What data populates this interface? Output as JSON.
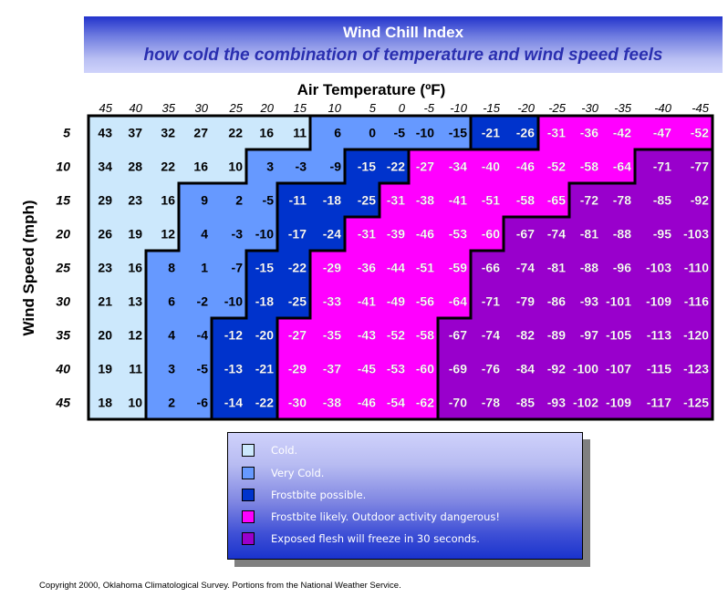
{
  "header": {
    "title": "Wind Chill Index",
    "subtitle": "how cold the combination of temperature and wind speed feels"
  },
  "chart_data": {
    "type": "heatmap",
    "title": "Wind Chill Index",
    "subtitle": "how cold the combination of temperature and wind speed feels",
    "xlabel": "Air Temperature (ºF)",
    "ylabel": "Wind Speed (mph)",
    "x": [
      45,
      40,
      35,
      30,
      25,
      20,
      15,
      10,
      5,
      0,
      -5,
      -10,
      -15,
      -20,
      -25,
      -30,
      -35,
      -40,
      -45
    ],
    "y": [
      5,
      10,
      15,
      20,
      25,
      30,
      35,
      40,
      45
    ],
    "values": [
      [
        43,
        37,
        32,
        27,
        22,
        16,
        11,
        6,
        0,
        -5,
        -10,
        -15,
        -21,
        -26,
        -31,
        -36,
        -42,
        -47,
        -52
      ],
      [
        34,
        28,
        22,
        16,
        10,
        3,
        -3,
        -9,
        -15,
        -22,
        -27,
        -34,
        -40,
        -46,
        -52,
        -58,
        -64,
        -71,
        -77
      ],
      [
        29,
        23,
        16,
        9,
        2,
        -5,
        -11,
        -18,
        -25,
        -31,
        -38,
        -41,
        -51,
        -58,
        -65,
        -72,
        -78,
        -85,
        -92
      ],
      [
        26,
        19,
        12,
        4,
        -3,
        -10,
        -17,
        -24,
        -31,
        -39,
        -46,
        -53,
        -60,
        -67,
        -74,
        -81,
        -88,
        -95,
        -103
      ],
      [
        23,
        16,
        8,
        1,
        -7,
        -15,
        -22,
        -29,
        -36,
        -44,
        -51,
        -59,
        -66,
        -74,
        -81,
        -88,
        -96,
        -103,
        -110
      ],
      [
        21,
        13,
        6,
        -2,
        -10,
        -18,
        -25,
        -33,
        -41,
        -49,
        -56,
        -64,
        -71,
        -79,
        -86,
        -93,
        -101,
        -109,
        -116
      ],
      [
        20,
        12,
        4,
        -4,
        -12,
        -20,
        -27,
        -35,
        -43,
        -52,
        -58,
        -67,
        -74,
        -82,
        -89,
        -97,
        -105,
        -113,
        -120
      ],
      [
        19,
        11,
        3,
        -5,
        -13,
        -21,
        -29,
        -37,
        -45,
        -53,
        -60,
        -69,
        -76,
        -84,
        -92,
        -100,
        -107,
        -115,
        -123
      ],
      [
        18,
        10,
        2,
        -6,
        -14,
        -22,
        -30,
        -38,
        -46,
        -54,
        -62,
        -70,
        -78,
        -85,
        -93,
        -102,
        -109,
        -117,
        -125
      ]
    ],
    "category_breaks": [
      [
        7,
        12,
        14,
        19
      ],
      [
        5,
        8,
        10,
        17
      ],
      [
        3,
        6,
        9,
        15
      ],
      [
        3,
        6,
        8,
        13
      ],
      [
        2,
        5,
        7,
        12
      ],
      [
        2,
        5,
        7,
        12
      ],
      [
        2,
        4,
        6,
        11
      ],
      [
        2,
        4,
        6,
        11
      ],
      [
        2,
        4,
        6,
        11
      ]
    ],
    "categories": [
      {
        "label": "Cold.",
        "color": "#cce8fc"
      },
      {
        "label": "Very Cold.",
        "color": "#6699ff"
      },
      {
        "label": "Frostbite possible.",
        "color": "#0033cc"
      },
      {
        "label": "Frostbite likely.  Outdoor activity dangerous!",
        "color": "#ff00ff"
      },
      {
        "label": "Exposed flesh will freeze in 30 seconds.",
        "color": "#9900cc"
      }
    ],
    "legend_position": "bottom-center"
  },
  "footer": {
    "copyright": "Copyright 2000, Oklahoma Climatological Survey.  Portions from the National Weather Service."
  }
}
